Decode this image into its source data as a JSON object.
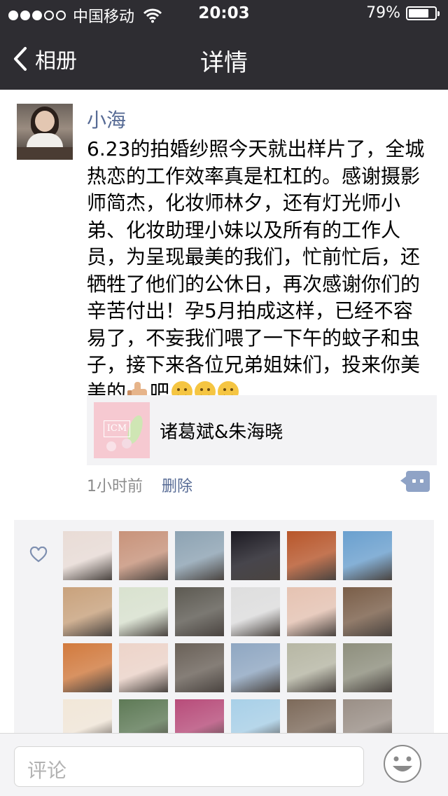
{
  "status": {
    "carrier": "中国移动",
    "time": "20:03",
    "battery": "79%",
    "battery_level": 0.79,
    "signal_bars": 3
  },
  "nav": {
    "back_label": "相册",
    "title": "详情"
  },
  "post": {
    "username": "小海",
    "text_main": "6.23的拍婚纱照今天就出样片了，全城热恋的工作效率真是杠杠的。感谢摄影师简杰，化妆师林夕，还有灯光师小弟、化妆助理小妹以及所有的工作人员，为呈现最美的我们，忙前忙后，还牺牲了他们的公休日，再次感谢你们的辛苦付出！孕5月拍成这样，已经不容易了，不妄我们喂了一下午的蚊子和虫子，接下来各位兄弟姐妹们，投来你美美的",
    "text_after_thumb": "吧",
    "emoji_after_text": [
      "thumbs-up-icon",
      "thinking-face-icon",
      "thinking-face-icon",
      "thinking-face-icon"
    ],
    "link_title": "诸葛斌&朱海晓",
    "time_ago": "1小时前",
    "delete_label": "删除"
  },
  "likes": {
    "icon": "heart-outline-icon",
    "avatar_colors": [
      [
        "#e9dcd6",
        "#c8937a",
        "#8da3b3",
        "#1c1a22",
        "#b8562a",
        "#6aa0cf"
      ],
      [
        "#c9a27c",
        "#d9e2cf",
        "#5d5a52",
        "#dedede",
        "#e6c3b2",
        "#7a5e48"
      ],
      [
        "#d27a3d",
        "#edd4c9",
        "#6a6158",
        "#8fa7c2",
        "#b7b7a4",
        "#8e8f7d"
      ],
      [
        "#f2e7d8",
        "#5e7a56",
        "#b84c7a",
        "#a8d0e8",
        "#7d6a5a",
        "#9a8f86"
      ]
    ]
  },
  "footer": {
    "comment_placeholder": "评论",
    "emoji_icon": "smiley-face-icon"
  },
  "colors": {
    "nav_bg": "#2e2d32",
    "link_blue": "#576b95",
    "panel_bg": "#f3f3f5"
  }
}
